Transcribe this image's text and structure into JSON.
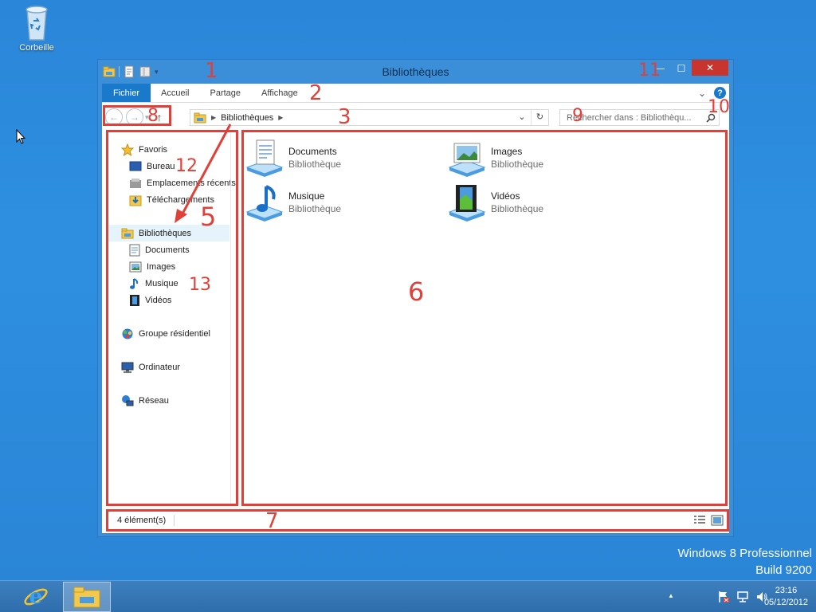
{
  "desktop": {
    "recycle_bin_label": "Corbeille",
    "watermark_line1": "Windows 8 Professionnel",
    "watermark_line2": "Build 9200"
  },
  "window": {
    "title": "Bibliothèques",
    "close_glyph": "✕",
    "minimize_glyph": "—",
    "maximize_glyph": "☐"
  },
  "ribbon": {
    "tabs": [
      "Fichier",
      "Accueil",
      "Partage",
      "Affichage"
    ],
    "help_glyph": "?",
    "collapse_glyph": "⌄"
  },
  "address": {
    "crumb": "Bibliothèques",
    "search_placeholder": "Rechercher dans : Bibliothèqu..."
  },
  "nav_pane": {
    "favorites": {
      "label": "Favoris",
      "items": [
        "Bureau",
        "Emplacements récents",
        "Téléchargements"
      ]
    },
    "libraries": {
      "label": "Bibliothèques",
      "items": [
        "Documents",
        "Images",
        "Musique",
        "Vidéos"
      ]
    },
    "homegroup": "Groupe résidentiel",
    "computer": "Ordinateur",
    "network": "Réseau"
  },
  "content": {
    "tiles": [
      {
        "name": "Documents",
        "sub": "Bibliothèque",
        "icon": "documents-library-icon"
      },
      {
        "name": "Images",
        "sub": "Bibliothèque",
        "icon": "images-library-icon"
      },
      {
        "name": "Musique",
        "sub": "Bibliothèque",
        "icon": "music-library-icon"
      },
      {
        "name": "Vidéos",
        "sub": "Bibliothèque",
        "icon": "videos-library-icon"
      }
    ]
  },
  "status": {
    "count": "4 élément(s)"
  },
  "annotations": [
    "1",
    "2",
    "3",
    "5",
    "6",
    "7",
    "8",
    "9",
    "10",
    "11",
    "12",
    "13"
  ],
  "taskbar": {
    "time": "23:16",
    "date": "05/12/2012",
    "tray_caret": "▲"
  },
  "colors": {
    "annotation_red": "#e04038",
    "ribbon_blue": "#1979ca",
    "desktop_blue": "#2a86d8"
  }
}
